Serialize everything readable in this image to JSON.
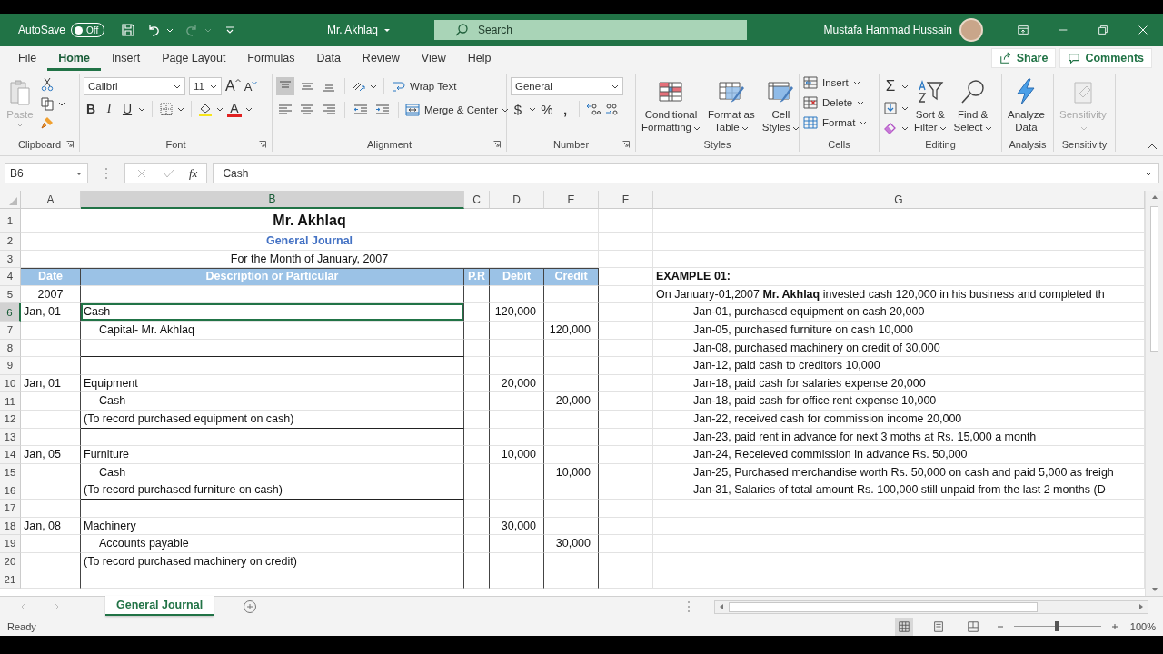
{
  "title_bar": {
    "autosave": {
      "label": "AutoSave",
      "state": "Off",
      "on": false
    },
    "redo_disabled": true,
    "document_title": "Mr. Akhlaq",
    "search": {
      "placeholder": "Search"
    },
    "user_name": "Mustafa Hammad Hussain"
  },
  "ribbon_tabs": [
    {
      "label": "File",
      "selected": false
    },
    {
      "label": "Home",
      "selected": true
    },
    {
      "label": "Insert",
      "selected": false
    },
    {
      "label": "Page Layout",
      "selected": false
    },
    {
      "label": "Formulas",
      "selected": false
    },
    {
      "label": "Data",
      "selected": false
    },
    {
      "label": "Review",
      "selected": false
    },
    {
      "label": "View",
      "selected": false
    },
    {
      "label": "Help",
      "selected": false
    }
  ],
  "share_button": "Share",
  "comments_button": "Comments",
  "ribbon": {
    "clipboard": {
      "label": "Clipboard",
      "paste": {
        "label": "Paste",
        "disabled": true
      }
    },
    "font": {
      "label": "Font",
      "font_name": "Calibri",
      "font_size": "11",
      "grow_font": "A",
      "shrink_font": "A",
      "bold": "B",
      "italic": "I",
      "underline": "U",
      "font_color": "A"
    },
    "alignment": {
      "label": "Alignment",
      "vertical_align": [
        {
          "selected": true
        },
        {
          "selected": false
        },
        {
          "selected": false
        }
      ],
      "wrap_text": "Wrap Text",
      "merge_center": "Merge & Center"
    },
    "number": {
      "label": "Number",
      "format": "General",
      "currency": "$",
      "percent": "%",
      "comma": ","
    },
    "styles": {
      "label": "Styles",
      "buttons": [
        "Conditional\nFormatting",
        "Format as\nTable",
        "Cell\nStyles"
      ]
    },
    "cells": {
      "label": "Cells",
      "buttons": [
        "Insert",
        "Delete",
        "Format"
      ]
    },
    "editing": {
      "label": "Editing",
      "autosum": "Σ",
      "buttons": [
        "Sort &\nFilter",
        "Find &\nSelect"
      ]
    },
    "analysis": {
      "label": "Analysis",
      "button": "Analyze\nData"
    },
    "sensitivity": {
      "label": "Sensitivity",
      "button": {
        "label": "Sensitivity",
        "disabled": true
      }
    }
  },
  "formula_bar": {
    "name_box": "B6",
    "insert_function": "fx",
    "formula": "Cash"
  },
  "sheet": {
    "columns": [
      {
        "label": "A",
        "selected": false
      },
      {
        "label": "B",
        "selected": true
      },
      {
        "label": "C",
        "selected": false
      },
      {
        "label": "D",
        "selected": false
      },
      {
        "label": "E",
        "selected": false
      },
      {
        "label": "F",
        "selected": false
      },
      {
        "label": "G",
        "selected": false
      }
    ],
    "rows": [
      {
        "number": "1",
        "kind": "title",
        "text": "Mr. Akhlaq",
        "selected": false
      },
      {
        "number": "2",
        "kind": "subtitle",
        "text": "General Journal",
        "selected": false
      },
      {
        "number": "3",
        "kind": "caption",
        "text": "For the Month of January, 2007",
        "selected": false
      },
      {
        "number": "4",
        "kind": "header",
        "a": "Date",
        "b": "Description or Particular",
        "c": "P.R",
        "d": "Debit",
        "e": "Credit",
        "g": "EXAMPLE 01:",
        "selected": false
      },
      {
        "number": "5",
        "kind": "year",
        "a": "2007",
        "g": "On January-01,2007 **Mr. Akhlaq** invested cash 120,000 in his business and completed th",
        "g_indented": false,
        "selected": false
      },
      {
        "number": "6",
        "kind": "entry",
        "a": "Jan, 01",
        "b": "Cash",
        "b_indented": false,
        "d": "120,000",
        "g": "Jan-01, purchased equipment on cash 20,000",
        "g_indented": true,
        "selected": true
      },
      {
        "number": "7",
        "kind": "entry",
        "b": "Capital- Mr. Akhlaq",
        "b_indented": true,
        "e": "120,000",
        "g": "Jan-05, purchased furniture on cash 10,000",
        "g_indented": true,
        "selected": false
      },
      {
        "number": "8",
        "kind": "entry",
        "closes_entry": true,
        "g": "Jan-08, purchased machinery on credit of 30,000",
        "g_indented": true,
        "selected": false
      },
      {
        "number": "9",
        "kind": "entry",
        "g": "Jan-12, paid cash to creditors 10,000",
        "g_indented": true,
        "selected": false
      },
      {
        "number": "10",
        "kind": "entry",
        "a": "Jan, 01",
        "b": "Equipment",
        "b_indented": false,
        "d": "20,000",
        "g": "Jan-18, paid cash for salaries expense 20,000",
        "g_indented": true,
        "selected": false
      },
      {
        "number": "11",
        "kind": "entry",
        "b": "Cash",
        "b_indented": true,
        "e": "20,000",
        "g": "Jan-18, paid cash for office rent expense 10,000",
        "g_indented": true,
        "selected": false
      },
      {
        "number": "12",
        "kind": "entry",
        "b": "(To record purchased equipment on cash)",
        "b_indented": false,
        "closes_entry": true,
        "g": "Jan-22, received cash for commission income 20,000",
        "g_indented": true,
        "selected": false
      },
      {
        "number": "13",
        "kind": "entry",
        "g": "Jan-23, paid rent in advance for next 3 moths at Rs. 15,000 a month",
        "g_indented": true,
        "selected": false
      },
      {
        "number": "14",
        "kind": "entry",
        "a": "Jan, 05",
        "b": "Furniture",
        "b_indented": false,
        "d": "10,000",
        "g": "Jan-24, Receieved commission in advance Rs. 50,000",
        "g_indented": true,
        "selected": false
      },
      {
        "number": "15",
        "kind": "entry",
        "b": "Cash",
        "b_indented": true,
        "e": "10,000",
        "g": "Jan-25, Purchased merchandise worth Rs. 50,000 on cash and paid 5,000 as freigh",
        "g_indented": true,
        "selected": false
      },
      {
        "number": "16",
        "kind": "entry",
        "b": "(To record purchased furniture on cash)",
        "b_indented": false,
        "closes_entry": true,
        "g": "Jan-31, Salaries of total amount Rs. 100,000 still unpaid from the last 2 months (D",
        "g_indented": true,
        "selected": false
      },
      {
        "number": "17",
        "kind": "entry",
        "selected": false
      },
      {
        "number": "18",
        "kind": "entry",
        "a": "Jan, 08",
        "b": "Machinery",
        "b_indented": false,
        "d": "30,000",
        "selected": false
      },
      {
        "number": "19",
        "kind": "entry",
        "b": "Accounts payable",
        "b_indented": true,
        "e": "30,000",
        "selected": false
      },
      {
        "number": "20",
        "kind": "entry",
        "b": "(To record purchased machinery on credit)",
        "b_indented": false,
        "closes_entry": true,
        "selected": false
      },
      {
        "number": "21",
        "kind": "entry",
        "selected": false
      }
    ]
  },
  "sheet_tabs": [
    {
      "label": "General Journal",
      "selected": true
    }
  ],
  "status_bar": {
    "status": "Ready",
    "view_modes": [
      {
        "selected": true
      },
      {
        "selected": false
      },
      {
        "selected": false
      }
    ],
    "zoom": {
      "level": 0.5,
      "reading": "100%"
    }
  }
}
